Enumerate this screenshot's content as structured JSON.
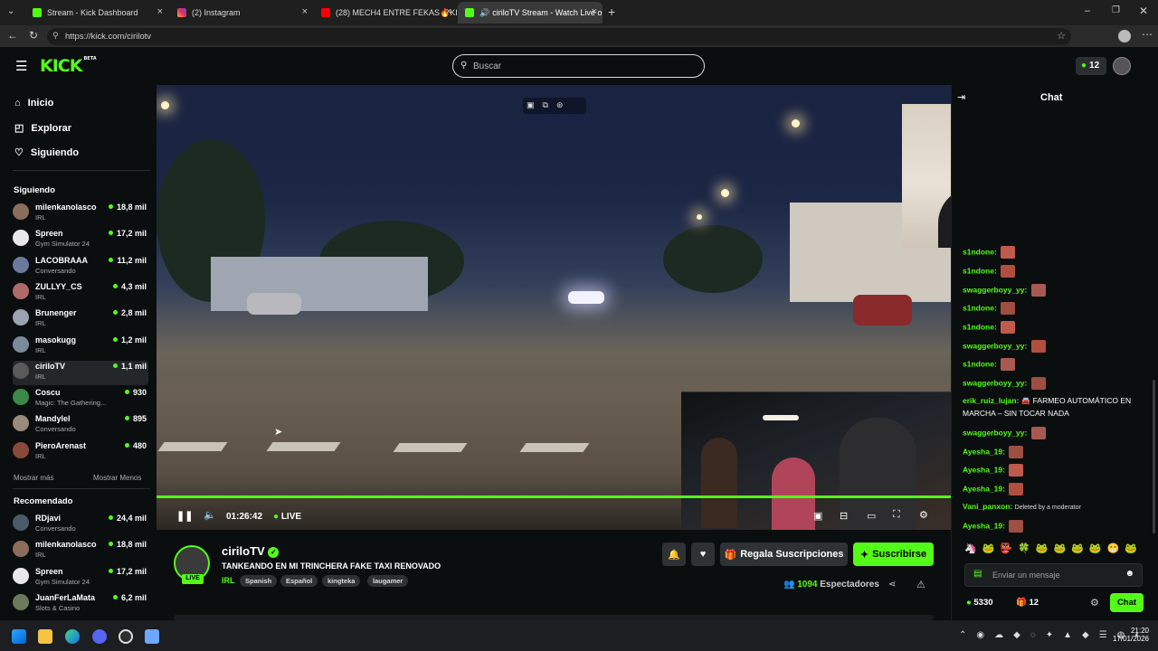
{
  "browser": {
    "tabs": [
      {
        "title": "Stream - Kick Dashboard",
        "active": false
      },
      {
        "title": "(2) Instagram",
        "active": false
      },
      {
        "title": "(28) MECH4 ENTRE FEKAS🔥KING",
        "active": false
      },
      {
        "title": "ciriloTV Stream - Watch Live o",
        "active": true
      }
    ],
    "url": "https://kick.com/cirilotv"
  },
  "header": {
    "logo": "KICK",
    "logo_sup": "BETA",
    "search_placeholder": "Buscar",
    "points": "12"
  },
  "sidebar": {
    "nav": [
      {
        "label": "Inicio",
        "icon": "home-icon"
      },
      {
        "label": "Explorar",
        "icon": "compass-icon"
      },
      {
        "label": "Siguiendo",
        "icon": "heart-icon"
      }
    ],
    "following_title": "Siguiendo",
    "following": [
      {
        "name": "milenkanolasco",
        "category": "IRL",
        "viewers": "18,8 mil",
        "color": "#8a6d5a"
      },
      {
        "name": "Spreen",
        "category": "Gym Simulator 24",
        "viewers": "17,2 mil",
        "color": "#e8e8e8"
      },
      {
        "name": "LACOBRAAA",
        "category": "Conversando",
        "viewers": "11,2 mil",
        "color": "#6b7a9a"
      },
      {
        "name": "ZULLYY_CS",
        "category": "IRL",
        "viewers": "4,3 mil",
        "color": "#b06a6a"
      },
      {
        "name": "Brunenger",
        "category": "IRL",
        "viewers": "2,8 mil",
        "color": "#9aa4b0"
      },
      {
        "name": "masokugg",
        "category": "IRL",
        "viewers": "1,2 mil",
        "color": "#7a8a9a"
      },
      {
        "name": "ciriloTV",
        "category": "IRL",
        "viewers": "1,1 mil",
        "color": "#5a5a5a"
      },
      {
        "name": "Coscu",
        "category": "Magic: The Gathering...",
        "viewers": "930",
        "color": "#3a8a4a"
      },
      {
        "name": "Mandylel",
        "category": "Conversando",
        "viewers": "895",
        "color": "#9a8a7a"
      },
      {
        "name": "PieroArenast",
        "category": "IRL",
        "viewers": "480",
        "color": "#8a4a3a"
      }
    ],
    "show_more": "Mostrar más",
    "show_less": "Mostrar Menos",
    "recommended_title": "Recomendado",
    "recommended": [
      {
        "name": "RDjavi",
        "category": "Conversando",
        "viewers": "24,4 mil",
        "color": "#4a5a6a"
      },
      {
        "name": "milenkanolasco",
        "category": "IRL",
        "viewers": "18,8 mil",
        "color": "#8a6d5a"
      },
      {
        "name": "Spreen",
        "category": "Gym Simulator 24",
        "viewers": "17,2 mil",
        "color": "#e8e8e8"
      },
      {
        "name": "JuanFerLaMata",
        "category": "Slots & Casino",
        "viewers": "6,2 mil",
        "color": "#6a7a5a"
      }
    ]
  },
  "player": {
    "time": "01:26:42",
    "live_label": "LIVE"
  },
  "stream": {
    "channel": "ciriloTV",
    "live_badge": "LIVE",
    "title": "TANKEANDO EN MI TRINCHERA FAKE TAXI RENOVADO",
    "category": "IRL",
    "tags": [
      "Spanish",
      "Español",
      "kingteka",
      "laugamer"
    ],
    "gift_label": "Regala Suscripciones",
    "subscribe_label": "Suscribirse",
    "viewers": "1094",
    "viewers_label": "Espectadores"
  },
  "chat": {
    "title": "Chat",
    "messages": [
      {
        "user": "s1ndone:",
        "text": ""
      },
      {
        "user": "s1ndone:",
        "text": ""
      },
      {
        "user": "swaggerboyy_yy:",
        "text": ""
      },
      {
        "user": "s1ndone:",
        "text": ""
      },
      {
        "user": "s1ndone:",
        "text": ""
      },
      {
        "user": "swaggerboyy_yy:",
        "text": ""
      },
      {
        "user": "s1ndone:",
        "text": ""
      },
      {
        "user": "swaggerboyy_yy:",
        "text": ""
      },
      {
        "user": "erik_ruiz_lujan:",
        "text": "🚘 FARMEO AUTOMÁTICO EN"
      },
      {
        "user": "",
        "text": "MARCHA – SIN TOCAR NADA"
      },
      {
        "user": "swaggerboyy_yy:",
        "text": ""
      },
      {
        "user": "Ayesha_19:",
        "text": ""
      },
      {
        "user": "Ayesha_19:",
        "text": ""
      },
      {
        "user": "Ayesha_19:",
        "text": ""
      },
      {
        "user": "Vani_panxon:",
        "text": "Deleted by a moderator"
      },
      {
        "user": "Ayesha_19:",
        "text": ""
      }
    ],
    "input_placeholder": "Enviar un mensaje",
    "points": "5330",
    "gifts": "12",
    "send_label": "Chat"
  },
  "taskbar": {
    "time": "21:20",
    "date": "17/01/2026"
  },
  "colors": {
    "accent": "#53fc18",
    "bg": "#0b0e0f"
  }
}
